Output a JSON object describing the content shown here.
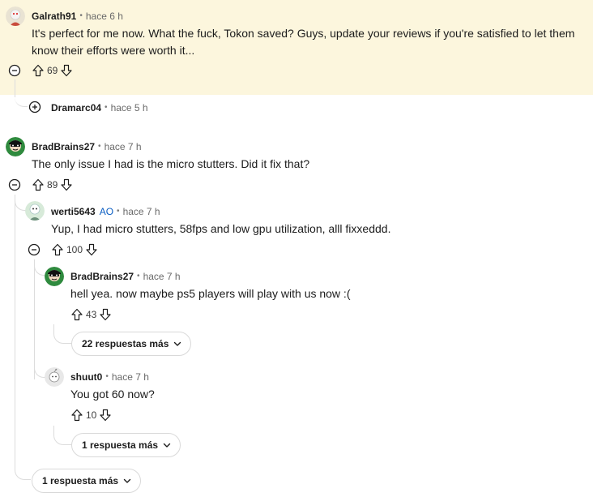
{
  "comments": {
    "galrath": {
      "username": "Galrath91",
      "time": "hace 6 h",
      "text": "It's perfect for me now. What the fuck, Tokon saved? Guys, update your reviews if you're satisfied to let them know their efforts were worth it...",
      "score": "69"
    },
    "dramarc": {
      "username": "Dramarc04",
      "time": "hace 5 h"
    },
    "brad_top": {
      "username": "BradBrains27",
      "time": "hace 7 h",
      "text": "The only issue I had is the micro stutters. Did it fix that?",
      "score": "89"
    },
    "werti": {
      "username": "werti5643",
      "badge": "AO",
      "time": "hace 7 h",
      "text": "Yup, I had micro stutters, 58fps and low gpu utilization, alll fixxeddd.",
      "score": "100"
    },
    "brad_reply": {
      "username": "BradBrains27",
      "time": "hace 7 h",
      "text": "hell yea. now maybe ps5 players will play with us now :(",
      "score": "43",
      "more": "22 respuestas más"
    },
    "shuut": {
      "username": "shuut0",
      "time": "hace 7 h",
      "text": "You got 60 now?",
      "score": "10",
      "more": "1 respuesta más"
    },
    "thread_more": "1 respuesta más"
  },
  "separator": "•",
  "icons": {
    "upvote": "arrow-up-outline-icon",
    "downvote": "arrow-down-outline-icon",
    "collapse": "minus-circle-icon",
    "expand": "plus-circle-icon",
    "chevron": "chevron-down-icon"
  },
  "colors": {
    "highlight": "#fcf6dd",
    "op_badge": "#0a5dc2",
    "thread_line": "#dcdcdc"
  }
}
